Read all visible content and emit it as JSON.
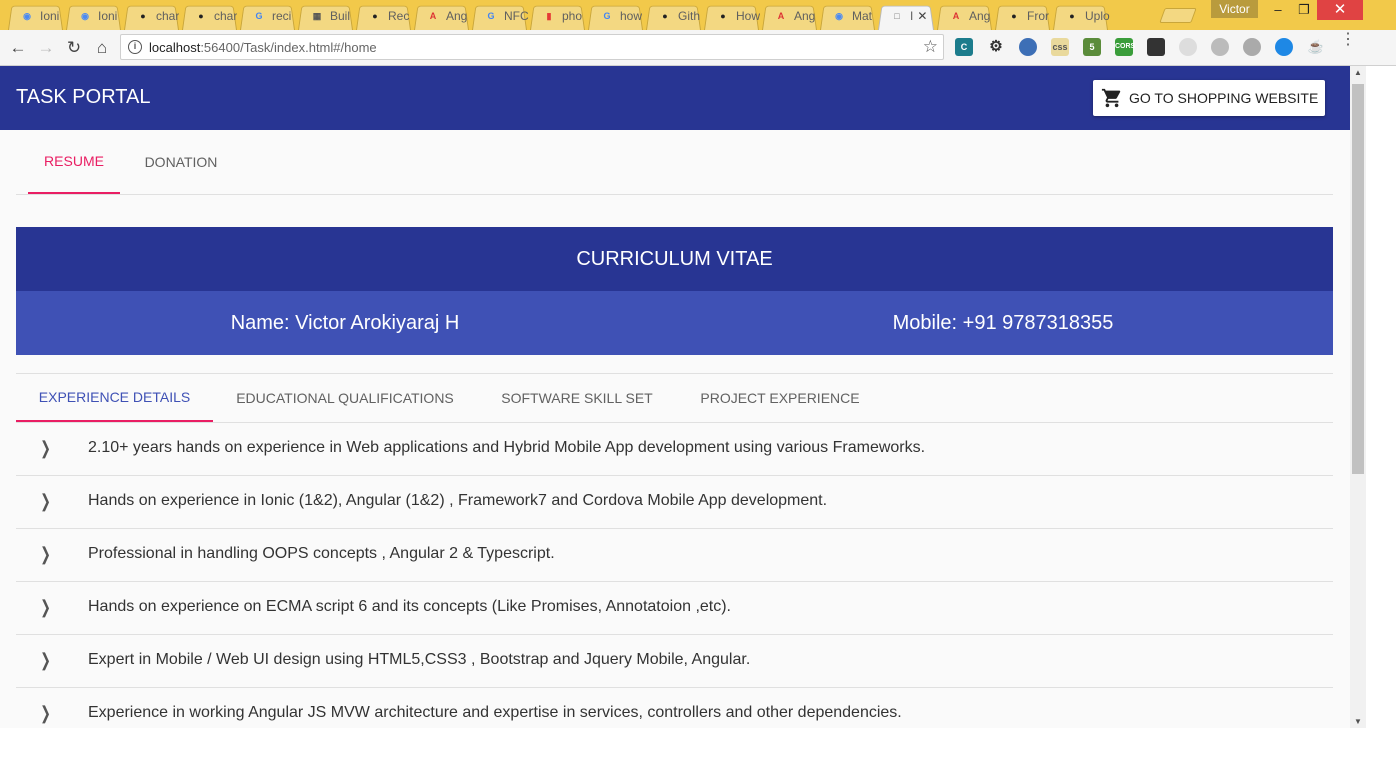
{
  "browser": {
    "tabs": [
      {
        "label": "Ioni",
        "icon": "ionic-icon",
        "color": "#4a8af4"
      },
      {
        "label": "Ioni",
        "icon": "ionic-icon",
        "color": "#4a8af4"
      },
      {
        "label": "char",
        "icon": "github-icon",
        "color": "#222222"
      },
      {
        "label": "char",
        "icon": "github-icon",
        "color": "#222222"
      },
      {
        "label": "reci",
        "icon": "google-icon",
        "color": "#4285f4"
      },
      {
        "label": "Buil",
        "icon": "book-icon",
        "color": "#555555"
      },
      {
        "label": "Rec",
        "icon": "github-icon",
        "color": "#222222"
      },
      {
        "label": "Ang",
        "icon": "angular-icon",
        "color": "#dd3333"
      },
      {
        "label": "NFC",
        "icon": "google-icon",
        "color": "#4285f4"
      },
      {
        "label": "pho",
        "icon": "bookmark-icon",
        "color": "#e53935"
      },
      {
        "label": "how",
        "icon": "google-icon",
        "color": "#4285f4"
      },
      {
        "label": "Gith",
        "icon": "github-icon",
        "color": "#222222"
      },
      {
        "label": "How",
        "icon": "github-icon",
        "color": "#222222"
      },
      {
        "label": "Ang",
        "icon": "angular-icon",
        "color": "#dd3333"
      },
      {
        "label": "Mat",
        "icon": "material-icon",
        "color": "#4a8af4"
      },
      {
        "label": "I",
        "icon": "page-icon",
        "color": "#777777",
        "active": true
      },
      {
        "label": "Ang",
        "icon": "angular-icon",
        "color": "#dd3333"
      },
      {
        "label": "Fror",
        "icon": "github-icon",
        "color": "#222222"
      },
      {
        "label": "Uplo",
        "icon": "github-icon",
        "color": "#222222"
      }
    ],
    "profile_name": "Victor",
    "url_host": "localhost",
    "url_rest": ":56400/Task/index.html#/home"
  },
  "app": {
    "title": "TASK PORTAL",
    "shop_button_label": "GO TO SHOPPING WEBSITE",
    "top_tabs": [
      {
        "label": "RESUME",
        "active": true
      },
      {
        "label": "DONATION",
        "active": false
      }
    ],
    "cv": {
      "heading": "CURRICULUM VITAE",
      "name": "Name: Victor Arokiyaraj H",
      "mobile": "Mobile: +91 9787318355"
    },
    "sub_tabs": [
      {
        "label": "EXPERIENCE DETAILS",
        "active": true
      },
      {
        "label": "EDUCATIONAL QUALIFICATIONS",
        "active": false
      },
      {
        "label": "SOFTWARE SKILL SET",
        "active": false
      },
      {
        "label": "PROJECT EXPERIENCE",
        "active": false
      }
    ],
    "experience": [
      "2.10+ years hands on experience in Web applications and Hybrid Mobile App development using various Frameworks.",
      "Hands on experience in Ionic (1&2), Angular (1&2) , Framework7 and Cordova Mobile App development.",
      "Professional in handling OOPS concepts , Angular 2 & Typescript.",
      "Hands on experience on ECMA script 6 and its concepts (Like Promises, Annotatoion ,etc).",
      "Expert in Mobile / Web UI design using HTML5,CSS3 , Bootstrap and Jquery Mobile, Angular.",
      "Experience in working Angular JS MVW architecture and expertise in services, controllers and other dependencies."
    ]
  },
  "colors": {
    "primary": "#283593",
    "primary_light": "#3f51b5",
    "accent": "#e91e63"
  }
}
